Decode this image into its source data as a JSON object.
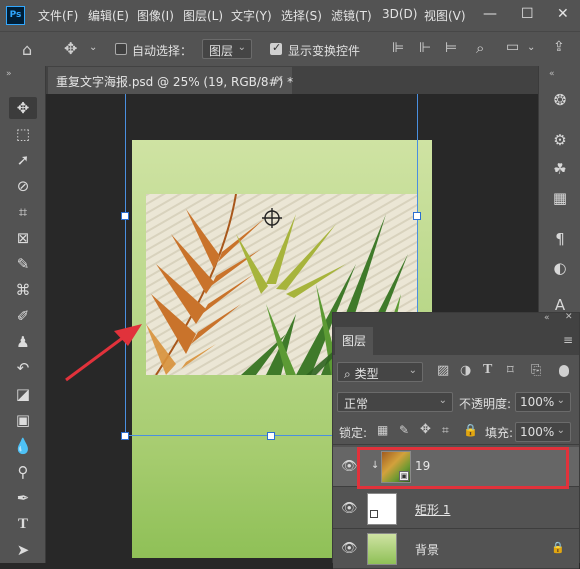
{
  "app": {
    "logo": "Ps"
  },
  "menu": {
    "items": [
      "文件(F)",
      "编辑(E)",
      "图像(I)",
      "图层(L)",
      "文字(Y)",
      "选择(S)",
      "滤镜(T)",
      "3D(D)",
      "视图(V)"
    ]
  },
  "options": {
    "auto_select_label": "自动选择：",
    "auto_select_target": "图层",
    "show_transform_label": "显示变换控件"
  },
  "document": {
    "tab_title": "重复文字海报.psd @ 25% (19, RGB/8#) *"
  },
  "layers_panel": {
    "title": "图层",
    "filter_kind": "类型",
    "blend_mode": "正常",
    "opacity_label": "不透明度:",
    "opacity_value": "100%",
    "lock_label": "锁定:",
    "fill_label": "填充:",
    "fill_value": "100%",
    "layers": [
      {
        "name": "19",
        "selected": true,
        "highlighted": true
      },
      {
        "name": "矩形 1",
        "selected": false
      },
      {
        "name": "背景",
        "selected": false,
        "locked": true
      }
    ]
  },
  "colors": {
    "accent_red": "#e1323b",
    "selection_blue": "#4a8fe0",
    "ps_blue": "#31a8ff"
  }
}
